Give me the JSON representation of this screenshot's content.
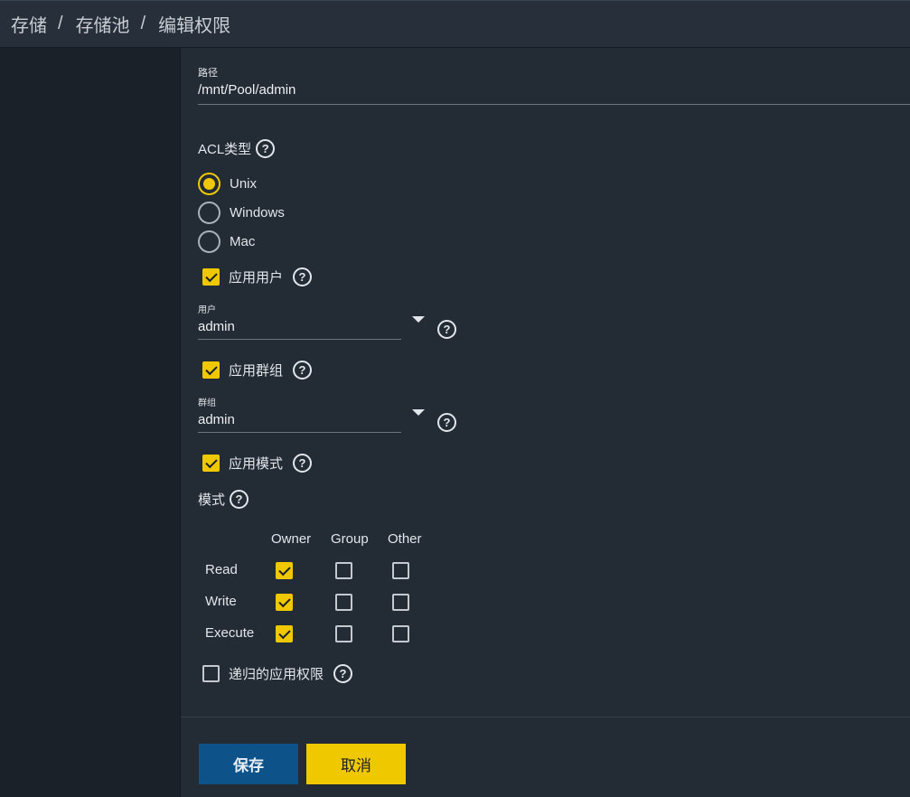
{
  "breadcrumb": {
    "items": [
      "存储",
      "存储池",
      "编辑权限"
    ],
    "separator": "/"
  },
  "path_field": {
    "label": "路径",
    "value": "/mnt/Pool/admin"
  },
  "acl_type": {
    "label": "ACL类型",
    "options": [
      "Unix",
      "Windows",
      "Mac"
    ],
    "selected": "Unix"
  },
  "apply_user": {
    "label": "应用用户",
    "checked": true
  },
  "user_field": {
    "label": "用户",
    "value": "admin"
  },
  "apply_group": {
    "label": "应用群组",
    "checked": true
  },
  "group_field": {
    "label": "群组",
    "value": "admin"
  },
  "apply_mode": {
    "label": "应用模式",
    "checked": true
  },
  "mode": {
    "label": "模式",
    "columns": [
      "Owner",
      "Group",
      "Other"
    ],
    "rows": [
      {
        "label": "Read",
        "values": [
          true,
          false,
          false
        ]
      },
      {
        "label": "Write",
        "values": [
          true,
          false,
          false
        ]
      },
      {
        "label": "Execute",
        "values": [
          true,
          false,
          false
        ]
      }
    ]
  },
  "recursive": {
    "label": "递归的应用权限",
    "checked": false
  },
  "buttons": {
    "save": "保存",
    "cancel": "取消"
  },
  "help_glyph": "?",
  "colors": {
    "accent_yellow": "#f0c800",
    "save_blue": "#0d5389",
    "background": "#232b35",
    "sidebar": "#1a2128"
  }
}
